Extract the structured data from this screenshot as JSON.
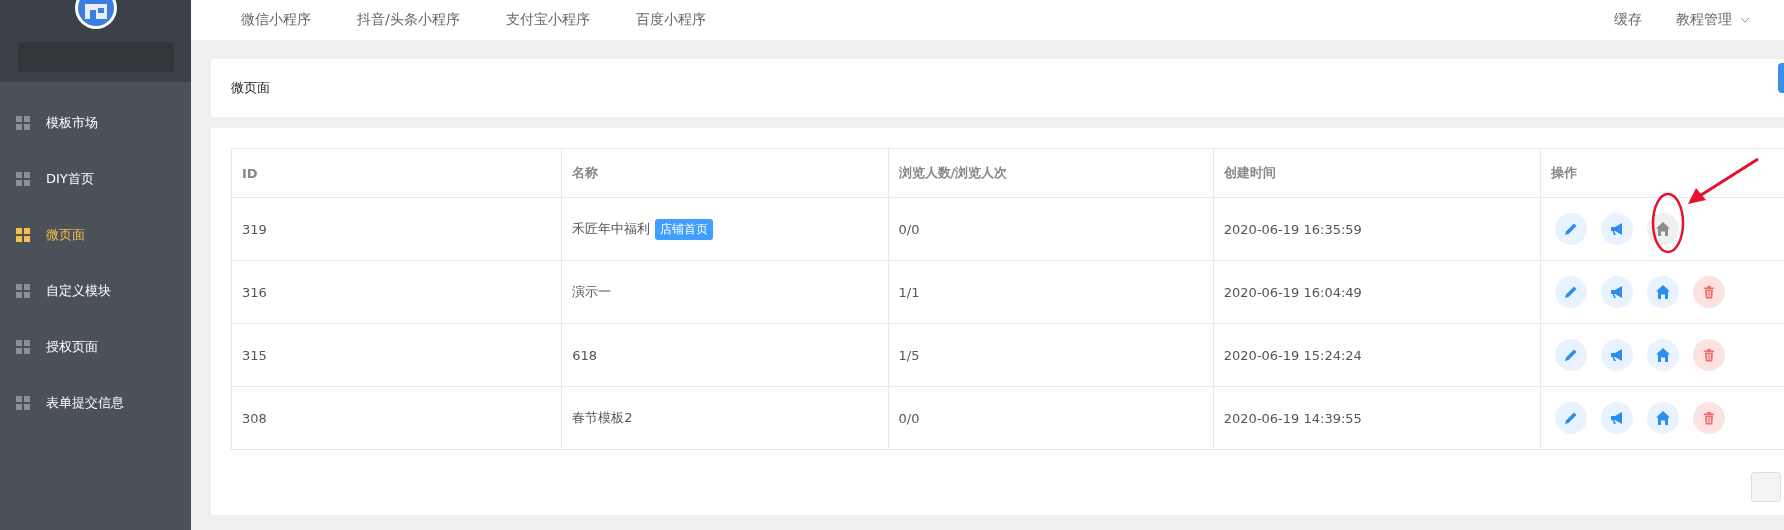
{
  "sidebar": {
    "items": [
      {
        "label": "模板市场",
        "selected": false
      },
      {
        "label": "DIY首页",
        "selected": false
      },
      {
        "label": "微页面",
        "selected": true
      },
      {
        "label": "自定义模块",
        "selected": false
      },
      {
        "label": "授权页面",
        "selected": false
      },
      {
        "label": "表单提交信息",
        "selected": false
      }
    ]
  },
  "top_nav": {
    "tabs": [
      "微信小程序",
      "抖音/头条小程序",
      "支付宝小程序",
      "百度小程序"
    ],
    "right": [
      {
        "label": "缓存",
        "kind": "link"
      },
      {
        "label": "教程管理",
        "kind": "dropdown"
      }
    ]
  },
  "page_header": {
    "title": "微页面"
  },
  "table": {
    "columns": [
      "ID",
      "名称",
      "浏览人数/浏览人次",
      "创建时间",
      "操作"
    ],
    "rows": [
      {
        "id": "319",
        "name": "禾匠年中福利",
        "tag": "店铺首页",
        "views": "0/0",
        "created": "2020-06-19 16:35:59",
        "is_home": true
      },
      {
        "id": "316",
        "name": "演示一",
        "views": "1/1",
        "created": "2020-06-19 16:04:49",
        "is_home": false
      },
      {
        "id": "315",
        "name": "618",
        "views": "1/5",
        "created": "2020-06-19 15:24:24",
        "is_home": false
      },
      {
        "id": "308",
        "name": "春节模板2",
        "views": "0/0",
        "created": "2020-06-19 14:39:55",
        "is_home": false
      }
    ]
  }
}
